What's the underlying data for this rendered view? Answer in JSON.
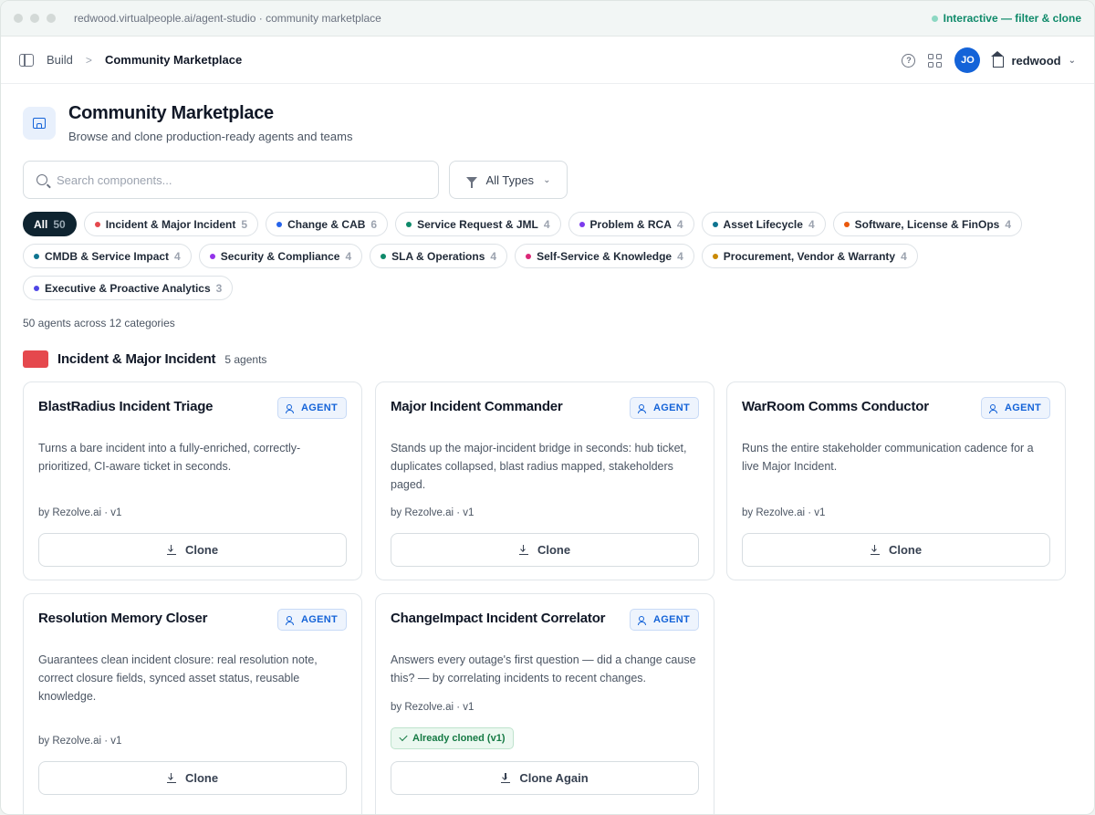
{
  "browser": {
    "url": "redwood.virtualpeople.ai/agent-studio · community marketplace",
    "status": "Interactive — filter & clone"
  },
  "header": {
    "breadcrumb_root": "Build",
    "breadcrumb_sep": ">",
    "breadcrumb_current": "Community Marketplace",
    "help_glyph": "?",
    "avatar_initials": "JO",
    "org_name": "redwood",
    "org_chevron": "⌄"
  },
  "page": {
    "title": "Community Marketplace",
    "subtitle": "Browse and clone production-ready agents and teams",
    "search_placeholder": "Search components...",
    "type_filter_label": "All Types",
    "type_filter_chevron": "⌄",
    "summary": "50 agents across 12 categories"
  },
  "chips": [
    {
      "label": "All",
      "count": "50",
      "color": "",
      "active": true
    },
    {
      "label": "Incident & Major Incident",
      "count": "5",
      "color": "#e5484d"
    },
    {
      "label": "Change & CAB",
      "count": "6",
      "color": "#2563eb"
    },
    {
      "label": "Service Request & JML",
      "count": "4",
      "color": "#0f8a6a"
    },
    {
      "label": "Problem & RCA",
      "count": "4",
      "color": "#7c3aed"
    },
    {
      "label": "Asset Lifecycle",
      "count": "4",
      "color": "#0e7490"
    },
    {
      "label": "Software, License & FinOps",
      "count": "4",
      "color": "#ea580c"
    },
    {
      "label": "CMDB & Service Impact",
      "count": "4",
      "color": "#0e7490"
    },
    {
      "label": "Security & Compliance",
      "count": "4",
      "color": "#9333ea"
    },
    {
      "label": "SLA & Operations",
      "count": "4",
      "color": "#0f8a6a"
    },
    {
      "label": "Self-Service & Knowledge",
      "count": "4",
      "color": "#db2777"
    },
    {
      "label": "Procurement, Vendor & Warranty",
      "count": "4",
      "color": "#ca8a04"
    },
    {
      "label": "Executive & Proactive Analytics",
      "count": "3",
      "color": "#4f46e5"
    }
  ],
  "section": {
    "title": "Incident & Major Incident",
    "count": "5 agents",
    "color": "#e5484d"
  },
  "cards": [
    {
      "title": "BlastRadius Incident Triage",
      "badge": "AGENT",
      "desc": "Turns a bare incident into a fully-enriched, correctly-prioritized, CI-aware ticket in seconds.",
      "by": "by Rezolve.ai · v1",
      "button": "Clone"
    },
    {
      "title": "Major Incident Commander",
      "badge": "AGENT",
      "desc": "Stands up the major-incident bridge in seconds: hub ticket, duplicates collapsed, blast radius mapped, stakeholders paged.",
      "by": "by Rezolve.ai · v1",
      "button": "Clone"
    },
    {
      "title": "WarRoom Comms Conductor",
      "badge": "AGENT",
      "desc": "Runs the entire stakeholder communication cadence for a live Major Incident.",
      "by": "by Rezolve.ai · v1",
      "button": "Clone"
    },
    {
      "title": "Resolution Memory Closer",
      "badge": "AGENT",
      "desc": "Guarantees clean incident closure: real resolution note, correct closure fields, synced asset status, reusable knowledge.",
      "by": "by Rezolve.ai · v1",
      "button": "Clone"
    },
    {
      "title": "ChangeImpact Incident Correlator",
      "badge": "AGENT",
      "desc": "Answers every outage's first question — did a change cause this? — by correlating incidents to recent changes.",
      "by": "by Rezolve.ai · v1",
      "cloned_label": "Already cloned (v1)",
      "button": "Clone Again"
    }
  ]
}
